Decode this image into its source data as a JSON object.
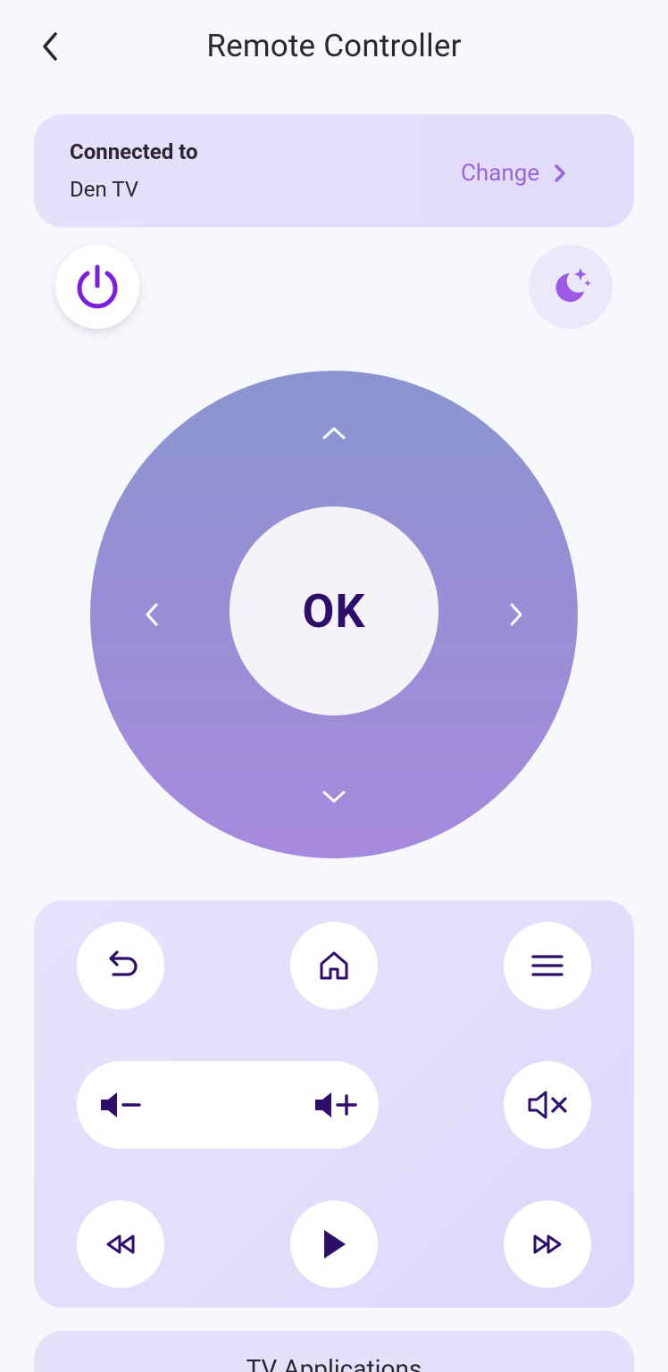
{
  "header": {
    "title": "Remote Controller",
    "back_icon": "chevron-left-icon"
  },
  "connection": {
    "label": "Connected to",
    "device_name": "Den TV",
    "change_label": "Change",
    "change_icon": "chevron-right-icon"
  },
  "top_controls": {
    "power_icon": "power-icon",
    "sleep_icon": "moon-sparkle-icon"
  },
  "dpad": {
    "ok_label": "OK",
    "up_icon": "chevron-up-icon",
    "down_icon": "chevron-down-icon",
    "left_icon": "chevron-left-icon",
    "right_icon": "chevron-right-icon"
  },
  "controls": {
    "row1": [
      "back-icon",
      "home-icon",
      "menu-icon"
    ],
    "volume": [
      "volume-down-icon",
      "volume-up-icon"
    ],
    "mute_icon": "mute-icon",
    "row3": [
      "rewind-icon",
      "play-icon",
      "fast-forward-icon"
    ]
  },
  "apps": {
    "title": "TV Applications"
  },
  "colors": {
    "accent": "#7a1fe0",
    "icon_dark": "#2f0d6b",
    "change_text": "#9b63d9",
    "card_bg": "#e6e0fb",
    "dpad_top": "#8a95cf",
    "dpad_bottom": "#a68add"
  }
}
